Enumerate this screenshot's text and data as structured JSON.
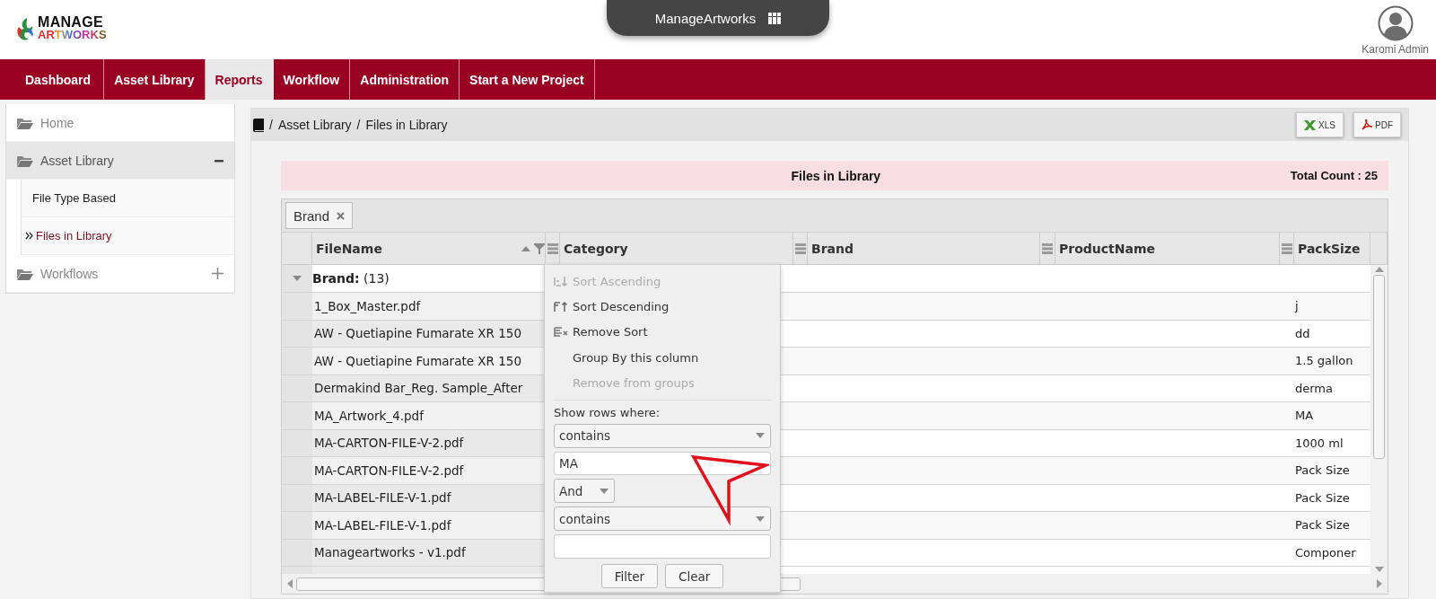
{
  "header": {
    "logo": {
      "line1": "MANAGE",
      "line2": "ARTWORKS"
    },
    "app_switcher": {
      "label": "ManageArtworks"
    },
    "user": {
      "name": "Karomi Admin"
    }
  },
  "nav": [
    {
      "label": "Dashboard",
      "selected": false
    },
    {
      "label": "Asset Library",
      "selected": false
    },
    {
      "label": "Reports",
      "selected": true
    },
    {
      "label": "Workflow",
      "selected": false
    },
    {
      "label": "Administration",
      "selected": false
    },
    {
      "label": "Start a New Project",
      "selected": false
    }
  ],
  "sidebar": {
    "items": [
      {
        "label": "Home",
        "kind": "link"
      },
      {
        "label": "Asset Library",
        "kind": "group",
        "expanded": true,
        "children": [
          {
            "label": "File Type Based",
            "selected": false
          },
          {
            "label": "Files in Library",
            "selected": true
          }
        ]
      },
      {
        "label": "Workflows",
        "kind": "group",
        "expanded": false
      }
    ]
  },
  "breadcrumb": {
    "separator": "/",
    "items": [
      "Asset Library",
      "Files in Library"
    ]
  },
  "exports": [
    {
      "label": "XLS",
      "kind": "xls"
    },
    {
      "label": "PDF",
      "kind": "pdf"
    }
  ],
  "report": {
    "title": "Files in Library",
    "total": "Total Count : 25"
  },
  "grid": {
    "group_panel": [
      {
        "label": "Brand"
      }
    ],
    "columns": [
      {
        "title": "FileName",
        "sorted": true,
        "filtered": true
      },
      {
        "title": "Category",
        "sorted": false,
        "filtered": false
      },
      {
        "title": "Brand",
        "sorted": false,
        "filtered": false
      },
      {
        "title": "ProductName",
        "sorted": false,
        "filtered": false
      },
      {
        "title": "PackSize",
        "sorted": false,
        "filtered": false
      }
    ],
    "group_row": {
      "label": "Brand:",
      "count": "(13)",
      "expanded": true
    },
    "rows": [
      {
        "file_name": "1_Box_Master.pdf",
        "pack_size": "j"
      },
      {
        "file_name": "AW - Quetiapine Fumarate XR 150",
        "pack_size": "dd"
      },
      {
        "file_name": "AW - Quetiapine Fumarate XR 150",
        "pack_size": "1.5 gallon"
      },
      {
        "file_name": "Dermakind Bar_Reg. Sample_After",
        "pack_size": "derma"
      },
      {
        "file_name": "MA_Artwork_4.pdf",
        "pack_size": "MA"
      },
      {
        "file_name": "MA-CARTON-FILE-V-2.pdf",
        "pack_size": "1000 ml"
      },
      {
        "file_name": "MA-CARTON-FILE-V-2.pdf",
        "pack_size": "Pack Size"
      },
      {
        "file_name": "MA-LABEL-FILE-V-1.pdf",
        "pack_size": "Pack Size"
      },
      {
        "file_name": "MA-LABEL-FILE-V-1.pdf",
        "pack_size": "Pack Size"
      },
      {
        "file_name": "Manageartworks - v1.pdf",
        "pack_size": "Componer"
      }
    ],
    "column_menu": {
      "items": [
        {
          "label": "Sort Ascending",
          "kind": "sort-asc",
          "disabled": true
        },
        {
          "label": "Sort Descending",
          "kind": "sort-desc",
          "disabled": false
        },
        {
          "label": "Remove Sort",
          "kind": "remove-sort",
          "disabled": false
        },
        {
          "label": "Group By this column",
          "kind": "group",
          "disabled": false
        },
        {
          "label": "Remove from groups",
          "kind": "ungroup",
          "disabled": true
        }
      ],
      "filter": {
        "label": "Show rows where:",
        "operator1": "contains",
        "value1": "MA",
        "logic": "And",
        "operator2": "contains",
        "buttons": [
          "Filter",
          "Clear"
        ]
      }
    }
  }
}
